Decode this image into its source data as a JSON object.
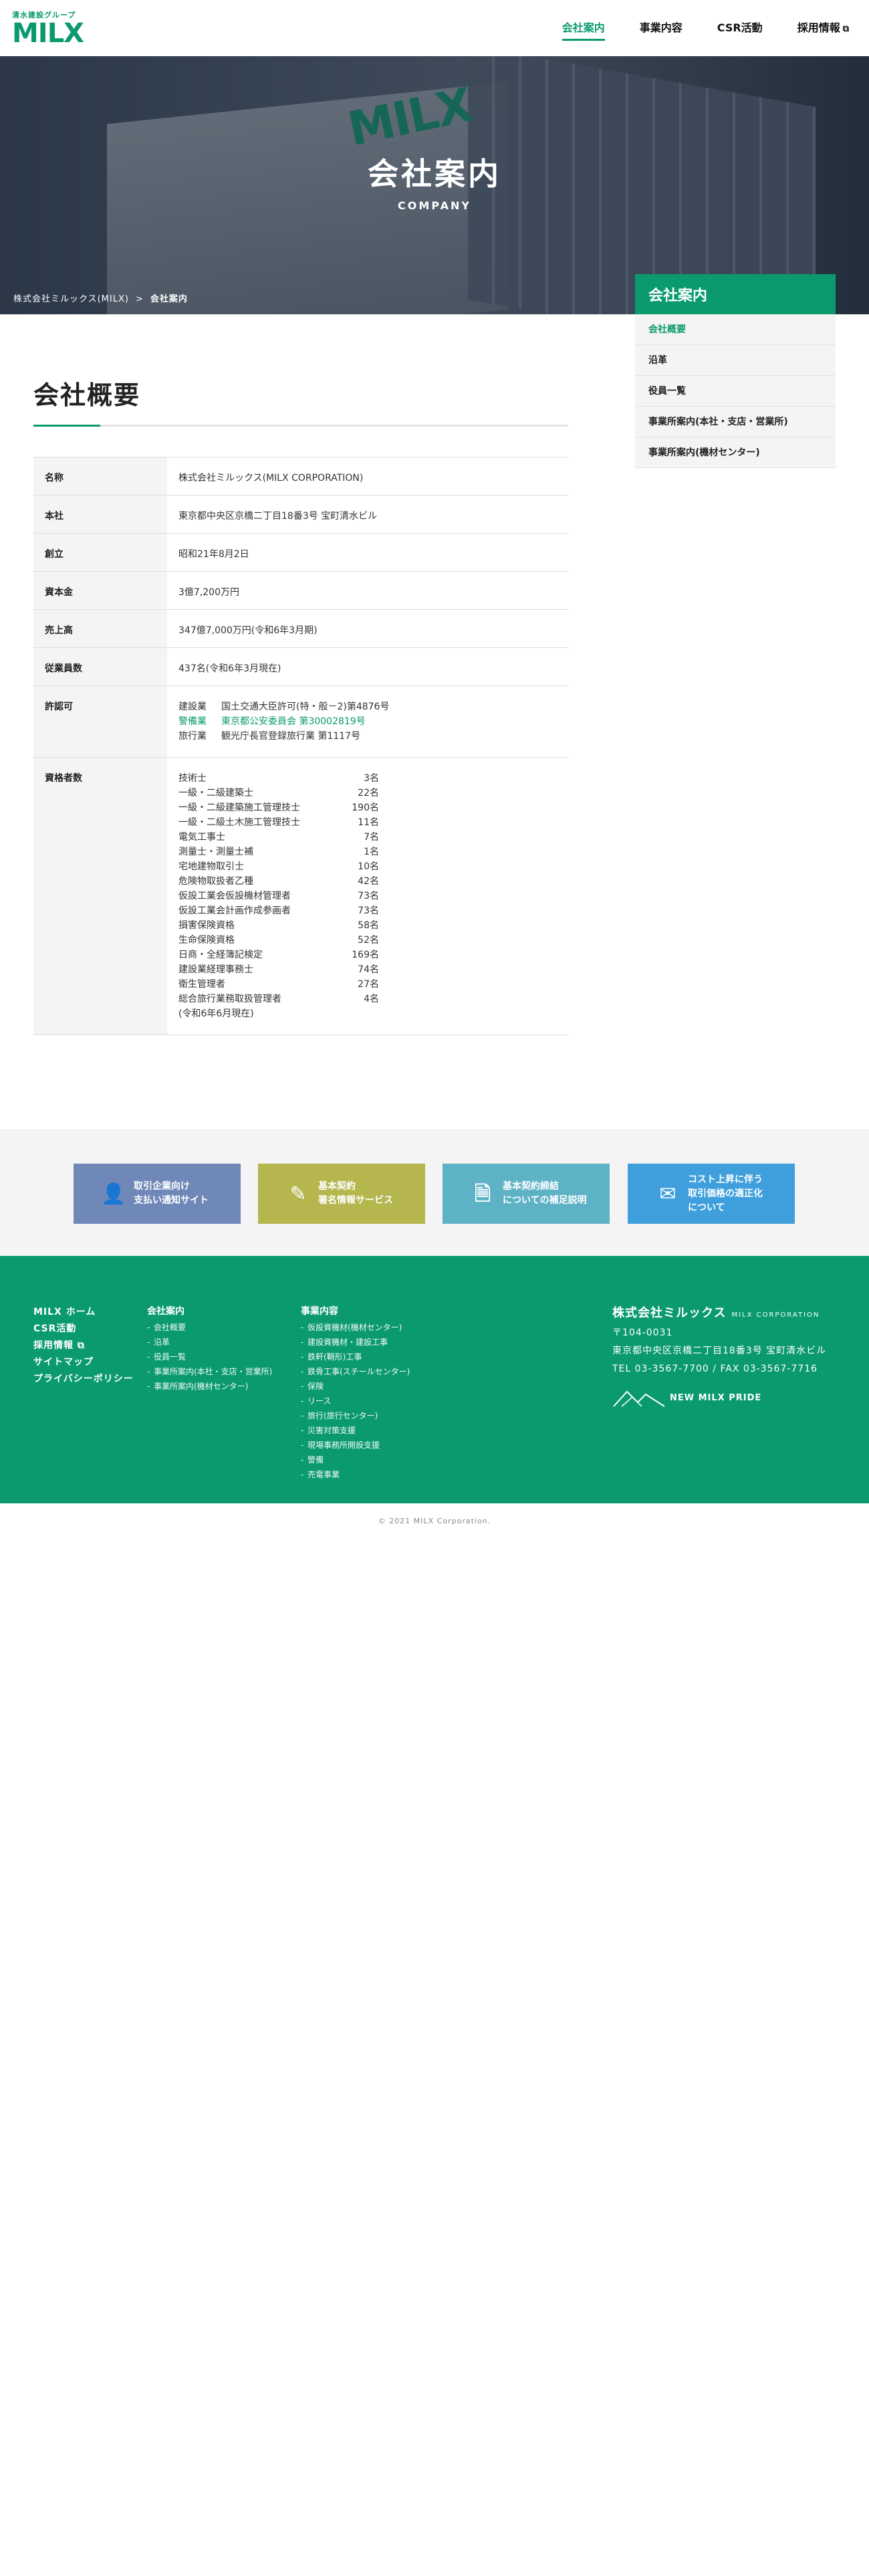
{
  "header": {
    "logo_sub": "清水建設グループ",
    "logo_main": "MILX",
    "nav": [
      {
        "label": "会社案内"
      },
      {
        "label": "事業内容"
      },
      {
        "label": "CSR活動"
      },
      {
        "label": "採用情報"
      }
    ]
  },
  "hero": {
    "sign": "MILX",
    "title": "会社案内",
    "subtitle": "COMPANY",
    "breadcrumb_home": "株式会社ミルックス(MILX)",
    "breadcrumb_sep": ">",
    "breadcrumb_current": "会社案内"
  },
  "sidebar": {
    "title": "会社案内",
    "items": [
      {
        "label": "会社概要"
      },
      {
        "label": "沿革"
      },
      {
        "label": "役員一覧"
      },
      {
        "label": "事業所案内(本社・支店・営業所)"
      },
      {
        "label": "事業所案内(機材センター)"
      }
    ]
  },
  "main": {
    "title": "会社概要",
    "rows": [
      {
        "label": "名称",
        "value": "株式会社ミルックス(MILX CORPORATION)"
      },
      {
        "label": "本社",
        "value": "東京都中央区京橋二丁目18番3号 宝町清水ビル"
      },
      {
        "label": "創立",
        "value": "昭和21年8月2日"
      },
      {
        "label": "資本金",
        "value": "3億7,200万円"
      },
      {
        "label": "売上高",
        "value": "347億7,000万円(令和6年3月期)"
      },
      {
        "label": "従業員数",
        "value": "437名(令和6年3月現在)"
      }
    ],
    "license_label": "許認可",
    "licenses": [
      {
        "k": "建設業",
        "v": "国土交通大臣許可(特・般－2)第4876号"
      },
      {
        "k": "警備業",
        "v": "東京都公安委員会 第30002819号"
      },
      {
        "k": "旅行業",
        "v": "観光庁長官登録旅行業 第1117号"
      }
    ],
    "qual_label": "資格者数",
    "quals": [
      {
        "k": "技術士",
        "v": "3名"
      },
      {
        "k": "一級・二級建築士",
        "v": "22名"
      },
      {
        "k": "一級・二級建築施工管理技士",
        "v": "190名"
      },
      {
        "k": "一級・二級土木施工管理技士",
        "v": "11名"
      },
      {
        "k": "電気工事士",
        "v": "7名"
      },
      {
        "k": "測量士・測量士補",
        "v": "1名"
      },
      {
        "k": "宅地建物取引士",
        "v": "10名"
      },
      {
        "k": "危険物取扱者乙種",
        "v": "42名"
      },
      {
        "k": "仮設工業会仮設機材管理者",
        "v": "73名"
      },
      {
        "k": "仮設工業会計画作成参画者",
        "v": "73名"
      },
      {
        "k": "損害保険資格",
        "v": "58名"
      },
      {
        "k": "生命保険資格",
        "v": "52名"
      },
      {
        "k": "日商・全経簿記検定",
        "v": "169名"
      },
      {
        "k": "建設業経理事務士",
        "v": "74名"
      },
      {
        "k": "衛生管理者",
        "v": "27名"
      },
      {
        "k": "総合旅行業務取扱管理者",
        "v": "4名"
      }
    ],
    "qual_note": "(令和6年6月現在)"
  },
  "banners": [
    {
      "line1": "取引企業向け",
      "line2": "支払い通知サイト",
      "line3": "",
      "color": "#6f88b8",
      "icon": "user-icon"
    },
    {
      "line1": "基本契約",
      "line2": "署名情報サービス",
      "line3": "",
      "color": "#b5b64e",
      "icon": "sign-doc-icon"
    },
    {
      "line1": "基本契約締結",
      "line2": "についての補足説明",
      "line3": "",
      "color": "#5db2c6",
      "icon": "document-icon"
    },
    {
      "line1": "コスト上昇に伴う",
      "line2": "取引価格の適正化",
      "line3": "について",
      "color": "#3e9fdc",
      "icon": "mail-icon"
    }
  ],
  "footer": {
    "col1": [
      "MILX ホーム",
      "CSR活動",
      "採用情報",
      "サイトマップ",
      "プライバシーポリシー"
    ],
    "col2_head": "会社案内",
    "col2": [
      "会社概要",
      "沿革",
      "役員一覧",
      "事業所案内(本社・支店・営業所)",
      "事業所案内(機材センター)"
    ],
    "col3_head": "事業内容",
    "col3": [
      "仮設資機材(機材センター)",
      "建設資機材・建設工事",
      "鉄軒(鞘形)工事",
      "鉄骨工事(スチールセンター)",
      "保険",
      "リース",
      "旅行(旅行センター)",
      "災害対策支援",
      "現場事務所開設支援",
      "警備",
      "売電事業"
    ],
    "company_name": "株式会社ミルックス",
    "company_en": "MILX CORPORATION",
    "zip": "〒104-0031",
    "address": "東京都中央区京橋二丁目18番3号 宝町清水ビル",
    "tel": "TEL 03-3567-7700 / FAX 03-3567-7716",
    "logo_text": "NEW MILX PRIDE"
  },
  "copyright": "© 2021 MILX Corporation."
}
